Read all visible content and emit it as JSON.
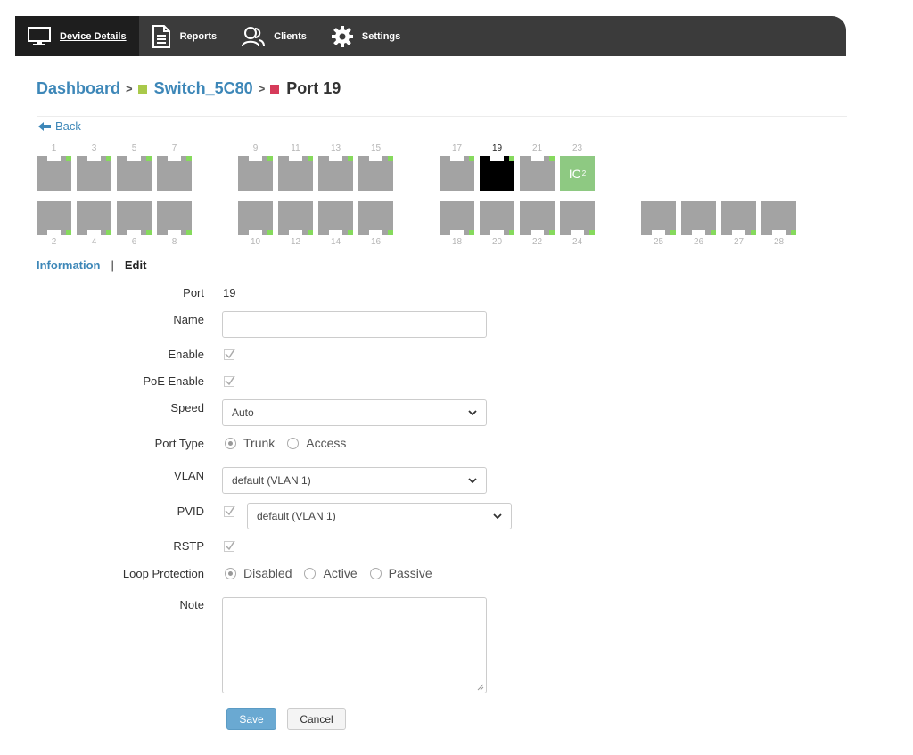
{
  "nav": {
    "items": [
      {
        "label": "Device Details",
        "icon": "monitor-icon"
      },
      {
        "label": "Reports",
        "icon": "document-icon"
      },
      {
        "label": "Clients",
        "icon": "users-icon"
      },
      {
        "label": "Settings",
        "icon": "gear-icon"
      }
    ]
  },
  "breadcrumb": {
    "dashboard": "Dashboard",
    "separator": ">",
    "switch": "Switch_5C80",
    "switch_color": "#a9c94a",
    "port": "Port 19",
    "port_color": "#d63b5a"
  },
  "back": "Back",
  "ports": {
    "top_labels": [
      "1",
      "3",
      "5",
      "7",
      "9",
      "11",
      "13",
      "15",
      "17",
      "19",
      "21",
      "23"
    ],
    "bottom_labels": [
      "2",
      "4",
      "6",
      "8",
      "10",
      "12",
      "14",
      "16",
      "18",
      "20",
      "22",
      "24",
      "25",
      "26",
      "27",
      "28"
    ],
    "selected": "19",
    "badge_text": "IC",
    "badge_sup": "2"
  },
  "tabs": {
    "information": "Information",
    "separator": "|",
    "edit": "Edit"
  },
  "form": {
    "port_label": "Port",
    "port_value": "19",
    "name_label": "Name",
    "name_value": "",
    "enable_label": "Enable",
    "poe_label": "PoE Enable",
    "speed_label": "Speed",
    "speed_value": "Auto",
    "port_type_label": "Port Type",
    "port_type_options": [
      "Trunk",
      "Access"
    ],
    "vlan_label": "VLAN",
    "vlan_value": "default (VLAN 1)",
    "pvid_label": "PVID",
    "pvid_value": "default (VLAN 1)",
    "rstp_label": "RSTP",
    "loop_label": "Loop Protection",
    "loop_options": [
      "Disabled",
      "Active",
      "Passive"
    ],
    "note_label": "Note",
    "note_value": ""
  },
  "buttons": {
    "save": "Save",
    "cancel": "Cancel"
  }
}
